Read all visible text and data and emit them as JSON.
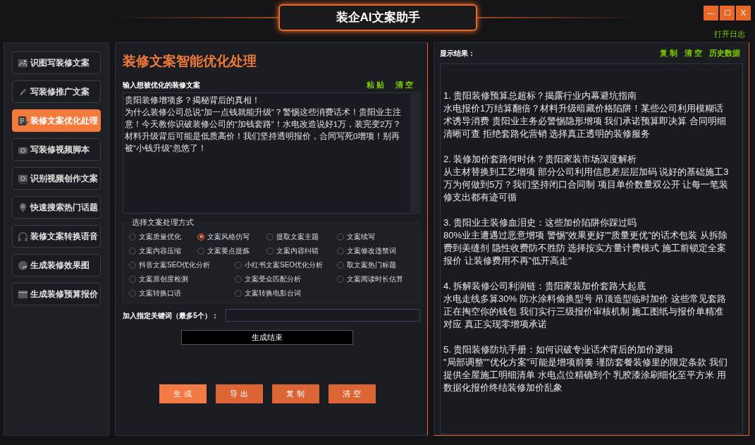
{
  "window": {
    "title": "装企AI文案助手",
    "controls": [
      "—",
      "☐",
      "X"
    ],
    "log_link": "打开日志"
  },
  "sidebar": {
    "items": [
      {
        "label": "识图写装修文案",
        "selected": false
      },
      {
        "label": "写装修推广文案",
        "selected": false
      },
      {
        "label": "装修文案优化处理",
        "selected": true
      },
      {
        "label": "写装修视频脚本",
        "selected": false
      },
      {
        "label": "识别视频创作文案",
        "selected": false
      },
      {
        "label": "快速搜索热门话题",
        "selected": false
      },
      {
        "label": "装修文案转换语音",
        "selected": false
      },
      {
        "label": "生成装修效果图",
        "selected": false
      },
      {
        "label": "生成装修预算报价",
        "selected": false
      }
    ]
  },
  "editor": {
    "heading": "装修文案智能优化处理",
    "input_label": "输入想被优化的装修文案",
    "input_actions": [
      "粘 贴",
      "清 空"
    ],
    "input_text": [
      "贵阳装修增项多？揭秘背后的真相！",
      "为什么装修公司总说“加一点钱就能升级”？警惕这些消费话术！贵阳业主注意！今天教你识破装修公司的“加钱套路”！水电改造说好1万，装完变2万？材料升级背后可能是低质高价！我们坚持透明报价，合同写死0增项！别再被“小钱升级”忽悠了！"
    ],
    "mode_group": "选择文案处理方式",
    "mode_rows": [
      [
        {
          "label": "文案质量优化",
          "selected": false
        },
        {
          "label": "文案风格仿写",
          "selected": true
        },
        {
          "label": "提取文案主题",
          "selected": false
        },
        {
          "label": "文案续写",
          "selected": false
        }
      ],
      [
        {
          "label": "文案内容压缩",
          "selected": false
        },
        {
          "label": "文案要点提炼",
          "selected": false
        },
        {
          "label": "文案内容纠错",
          "selected": false
        },
        {
          "label": "文案修改违禁词",
          "selected": false
        }
      ],
      [
        {
          "label": "抖音文案SEO优化分析",
          "selected": false
        },
        {
          "label": "小红书文案SEO优化分析",
          "selected": false
        },
        {
          "label": "取文案热门标题",
          "selected": false
        }
      ],
      [
        {
          "label": "文案原创度检测",
          "selected": false
        },
        {
          "label": "文案受众匹配分析",
          "selected": false
        },
        {
          "label": "文案阅读时长估算",
          "selected": false
        }
      ],
      [
        {
          "label": "文案转换口语",
          "selected": false
        },
        {
          "label": "文案转换电影台词",
          "selected": false
        }
      ]
    ],
    "keyword_label": "加入指定关键词（最多5个）：",
    "status": "生成结束",
    "buttons": [
      "生 成",
      "导 出",
      "复 制",
      "清 空"
    ]
  },
  "result": {
    "label": "显示结果：",
    "actions": [
      "复 制",
      "清 空",
      "历史数据"
    ],
    "items": [
      {
        "title": "1. 贵阳装修预算总超标？揭露行业内幕避坑指南",
        "body": "水电报价1万结算翻倍？材料升级暗藏价格陷阱！某些公司利用模糊话术诱导消费 贵阳业主务必警惕隐形增项 我们承诺预算即决算 合同明细清晰可查 拒绝套路化营销 选择真正透明的装修服务"
      },
      {
        "title": "2. 装修加价套路何时休？贵阳家装市场深度解析",
        "body": "从主材替换到工艺增项 部分公司利用信息差层层加码 说好的基础施工3万为何做到5万？我们坚持闭口合同制 项目单价数量双公开 让每一笔装修支出都有迹可循"
      },
      {
        "title": "3. 贵阳业主装修血泪史：这些加价陷阱你踩过吗",
        "body": "80%业主遭遇过恶意增项 警惕\"效果更好\"\"质量更优\"的话术包装 从拆除费到美缝剂 隐性收费防不胜防 选择按实方量计费模式 施工前锁定全案报价 让装修费用不再\"低开高走\""
      },
      {
        "title": "4. 拆解装修公司利润链：贵阳家装加价套路大起底",
        "body": "水电走线多算30% 防水涂料偷换型号 吊顶造型临时加价 这些常见套路正在掏空你的钱包 我们实行三级报价审核机制 施工图纸与报价单精准对应 真正实现零增项承诺"
      },
      {
        "title": "5. 贵阳装修防坑手册：如何识破专业话术背后的加价逻辑",
        "body": "\"局部调整\"\"优化方案\"可能是增项前奏 谨防套餐装修里的限定条款 我们提供全屋施工明细清单 水电点位精确到个 乳胶漆涂刷细化至平方米 用数据化报价终结装修加价乱象"
      }
    ]
  }
}
